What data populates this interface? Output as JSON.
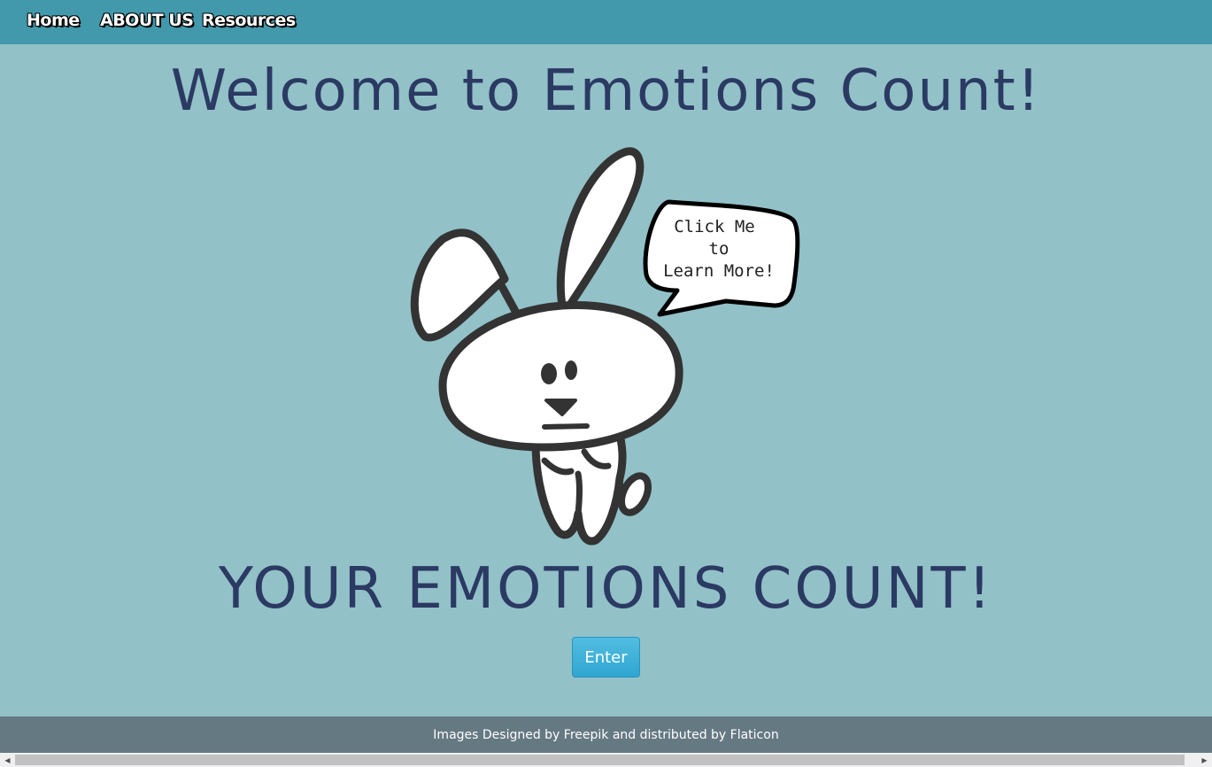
{
  "nav": {
    "home": "Home",
    "about": "ABOUT US",
    "resources": "Resources"
  },
  "main": {
    "title": "Welcome to Emotions Count!",
    "bubble_line1": "Click Me",
    "bubble_line2": "to",
    "bubble_line3": "Learn More!",
    "tagline": "YOUR EMOTIONS COUNT!",
    "enter_label": "Enter"
  },
  "footer": {
    "credit": "Images Designed by Freepik and distributed by Flaticon"
  },
  "icons": {
    "scroll_left": "scroll-left-arrow-icon",
    "scroll_right": "scroll-right-arrow-icon"
  },
  "colors": {
    "navbar": "#4299ab",
    "page_background": "#92c1c8",
    "heading_text": "#2b3a63",
    "enter_button": "#3fb1db",
    "footer": "#657983"
  }
}
